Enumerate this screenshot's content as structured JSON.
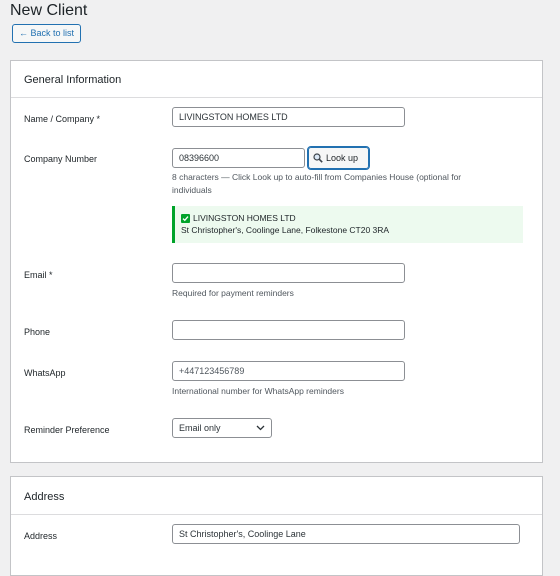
{
  "page": {
    "title": "New Client",
    "back_label": "← Back to list"
  },
  "general": {
    "title": "General Information",
    "name": {
      "label": "Name / Company *",
      "value": "LIVINGSTON HOMES LTD"
    },
    "company_number": {
      "label": "Company Number",
      "value": "08396600",
      "lookup_label": "Look up",
      "lookup_icon": "search-icon",
      "desc_line1": "8 characters — Click Look up to auto-fill from Companies House (optional for",
      "desc_line2": "individuals"
    },
    "lookup_result": {
      "name": "LIVINGSTON HOMES LTD",
      "address": "St Christopher's, Coolinge Lane, Folkestone CT20 3RA",
      "icon": "check-icon",
      "color": "#00a32a"
    },
    "email": {
      "label": "Email *",
      "value": "",
      "desc": "Required for payment reminders"
    },
    "phone": {
      "label": "Phone",
      "value": ""
    },
    "whatsapp": {
      "label": "WhatsApp",
      "placeholder": "+447123456789",
      "desc": "International number for WhatsApp reminders"
    },
    "reminder": {
      "label": "Reminder Preference",
      "value": "Email only"
    }
  },
  "address": {
    "title": "Address",
    "address": {
      "label": "Address",
      "value": "St Christopher's, Coolinge Lane"
    }
  },
  "colors": {
    "accent": "#2271b1",
    "success": "#00a32a",
    "background": "#f0f0f1"
  }
}
